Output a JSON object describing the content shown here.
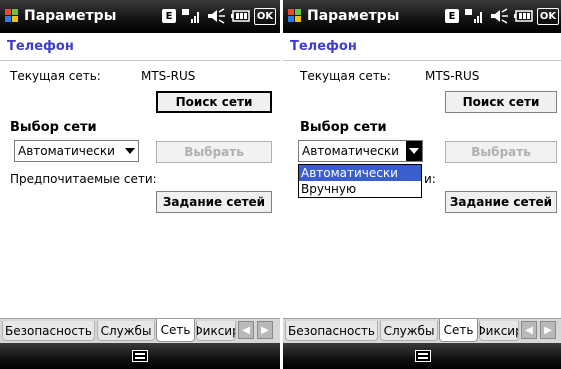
{
  "screens": [
    {
      "title": "Параметры",
      "status": {
        "edge": "E",
        "ok": "OK"
      },
      "heading": "Телефон",
      "current_network_label": "Текущая сеть:",
      "current_network_value": "MTS-RUS",
      "search_button": "Поиск сети",
      "network_selection_label": "Выбор сети",
      "combo_value": "Автоматически",
      "select_button": "Выбрать",
      "preferred_label": "Предпочитаемые сети:",
      "set_networks_button": "Задание сетей",
      "tabs": [
        "Безопасность",
        "Службы",
        "Сеть",
        "Фиксир"
      ]
    },
    {
      "title": "Параметры",
      "status": {
        "edge": "E",
        "ok": "OK"
      },
      "heading": "Телефон",
      "current_network_label": "Текущая сеть:",
      "current_network_value": "MTS-RUS",
      "search_button": "Поиск сети",
      "network_selection_label": "Выбор сети",
      "combo_value": "Автоматически",
      "dropdown_options": [
        "Автоматически",
        "Вручную"
      ],
      "select_button": "Выбрать",
      "preferred_label_partial": "и:",
      "set_networks_button": "Задание сетей",
      "tabs": [
        "Безопасность",
        "Службы",
        "Сеть",
        "Фиксир"
      ]
    }
  ],
  "icons": [
    "windows-logo-icon",
    "edge-icon",
    "signal-icon",
    "speaker-icon",
    "battery-icon",
    "keyboard-icon"
  ],
  "colors": {
    "heading": "#3e3ecb",
    "title_bar": "#000000",
    "selected_option": "#3a5fcd",
    "disabled_text": "#b0b0b0"
  }
}
